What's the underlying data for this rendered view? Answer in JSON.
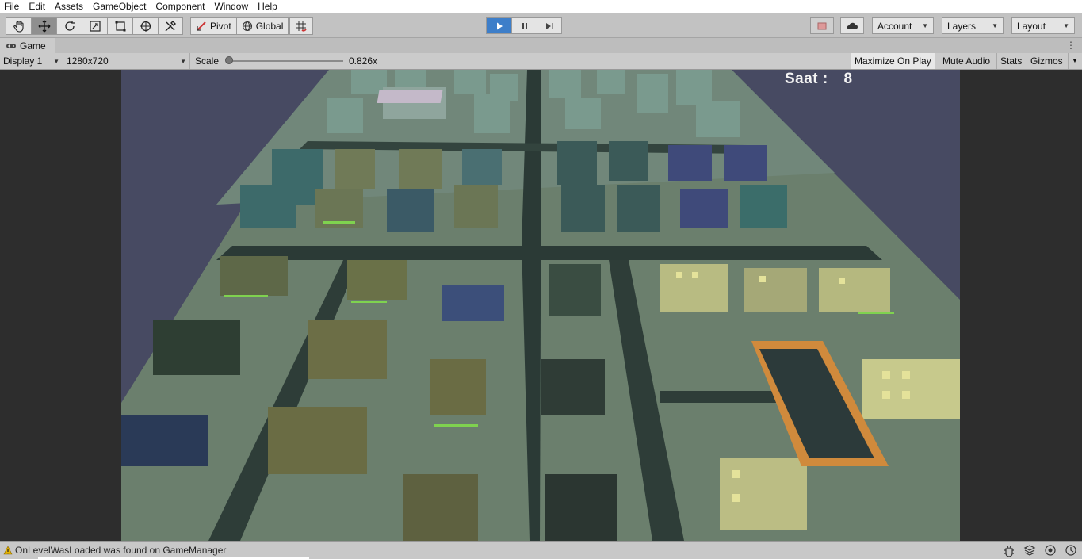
{
  "menu": [
    "File",
    "Edit",
    "Assets",
    "GameObject",
    "Component",
    "Window",
    "Help"
  ],
  "toolbar": {
    "tools": [
      "hand-tool-icon",
      "move-tool-icon",
      "rotate-tool-icon",
      "scale-tool-icon",
      "rect-tool-icon",
      "transform-tool-icon",
      "custom-tool-icon"
    ],
    "pivot_label": "Pivot",
    "global_label": "Global",
    "account_label": "Account",
    "layers_label": "Layers",
    "layout_label": "Layout"
  },
  "game_tab": {
    "label": "Game"
  },
  "game_bar": {
    "display_label": "Display 1",
    "resolution_label": "1280x720",
    "scale_label": "Scale",
    "scale_value": "0.826x",
    "maximize_label": "Maximize On Play",
    "mute_label": "Mute Audio",
    "stats_label": "Stats",
    "gizmos_label": "Gizmos"
  },
  "hud": {
    "saat_label": "Saat :",
    "saat_value": "8"
  },
  "status": {
    "message": "OnLevelWasLoaded was found on GameManager"
  },
  "colors": {
    "ground": "#6f8471",
    "road": "#2a3a35",
    "building_dark": "#3b4a3c",
    "building_olive": "#6b6d42",
    "building_teal": "#3d6a6a",
    "building_blue": "#2f3f7a",
    "lit_window": "#e6e39c",
    "park": "#d98a3a",
    "play_accent": "#3d7ec9"
  }
}
